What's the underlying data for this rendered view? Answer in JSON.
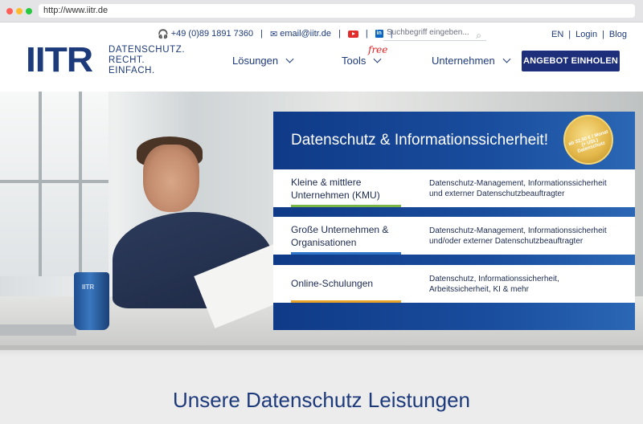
{
  "browser": {
    "url": "http://www.iitr.de"
  },
  "header": {
    "logo": {
      "mark": "IITR",
      "tagline": [
        "DATENSCHUTZ.",
        "RECHT.",
        "EINFACH."
      ]
    },
    "contact": {
      "phone": "+49 (0)89 1891 7360",
      "email": "email@iitr.de"
    },
    "search": {
      "placeholder": "Suchbegriff eingeben..."
    },
    "lang": {
      "en": "EN",
      "login": "Login",
      "blog": "Blog"
    },
    "nav": [
      {
        "label": "Lösungen"
      },
      {
        "label": "Tools",
        "badge": "free"
      },
      {
        "label": "Unternehmen"
      }
    ],
    "cta_label": "ANGEBOT EINHOLEN"
  },
  "hero": {
    "mug_text": "IITR",
    "panel_title": "Datenschutz & Informationssicherheit!",
    "seal_text": "ab 32,50 € / Monat (+ USt.) Datenschutz",
    "cards": [
      {
        "title_lines": [
          "Kleine & mittlere",
          "Unternehmen (KMU)"
        ],
        "desc_lines": [
          "Datenschutz-Management, Informationssicherheit",
          "und externer Datenschutzbeauftragter"
        ],
        "accent": "#7ab648"
      },
      {
        "title_lines": [
          "Große Unternehmen &",
          "Organisationen"
        ],
        "desc_lines": [
          "Datenschutz-Management, Informationssicherheit",
          "und/oder externer Datenschutzbeauftragter"
        ],
        "accent": "#2e74c9"
      },
      {
        "title_lines": [
          "Online-Schulungen"
        ],
        "desc_lines": [
          "Datenschutz, Informationssicherheit,",
          "Arbeitssicherheit, KI & mehr"
        ],
        "accent": "#e8a32a"
      }
    ]
  },
  "section": {
    "title": "Unsere Datenschutz Leistungen"
  },
  "colors": {
    "brand": "#1d3a7a",
    "cta": "#1d2f7a",
    "free": "#e02020"
  }
}
